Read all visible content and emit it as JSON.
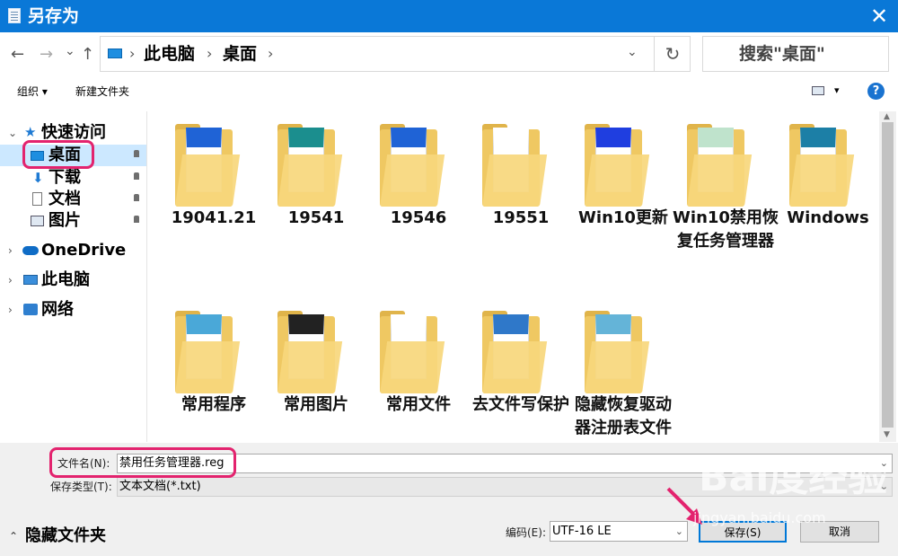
{
  "window": {
    "title": "另存为",
    "close_glyph": "✕"
  },
  "address": {
    "back_glyph": "←",
    "forward_glyph": "→",
    "recent_glyph": "⌄",
    "up_glyph": "↑",
    "crumbs": [
      "此电脑",
      "桌面"
    ],
    "sep_glyph": "›",
    "dropdown_glyph": "⌄",
    "refresh_glyph": "↻",
    "search_placeholder": "搜索\"桌面\""
  },
  "toolbar": {
    "organize": "组织 ▾",
    "new_folder": "新建文件夹",
    "view_glyph": "▾",
    "help_glyph": "?"
  },
  "nav": {
    "quick_access": "快速访问",
    "items": [
      {
        "label": "桌面",
        "icon": "desktop-icon"
      },
      {
        "label": "下载",
        "icon": "download-icon"
      },
      {
        "label": "文档",
        "icon": "document-icon"
      },
      {
        "label": "图片",
        "icon": "pictures-icon"
      }
    ],
    "onedrive": "OneDrive",
    "this_pc": "此电脑",
    "network": "网络"
  },
  "files": [
    {
      "name": "19041.21"
    },
    {
      "name": "19541"
    },
    {
      "name": "19546"
    },
    {
      "name": "19551"
    },
    {
      "name": "Win10更新"
    },
    {
      "name": "Win10禁用恢复任务管理器"
    },
    {
      "name": "Windows"
    },
    {
      "name": "常用程序"
    },
    {
      "name": "常用图片"
    },
    {
      "name": "常用文件"
    },
    {
      "name": "去文件写保护"
    },
    {
      "name": "隐藏恢复驱动器注册表文件"
    }
  ],
  "footer": {
    "filename_label": "文件名(N):",
    "filename_value": "禁用任务管理器.reg",
    "filetype_label": "保存类型(T):",
    "filetype_value": "文本文档(*.txt)",
    "encoding_label": "编码(E):",
    "encoding_value": "UTF-16 LE",
    "save": "保存(S)",
    "cancel": "取消",
    "hide_folders": "隐藏文件夹"
  },
  "watermark": {
    "brand": "Bai度经验",
    "url": "jingyan.baidu.com"
  },
  "colors": {
    "titlebar": "#0a78d7",
    "highlight": "#e3236e",
    "folder": "#f7d77c",
    "accent": "#0078d7"
  }
}
